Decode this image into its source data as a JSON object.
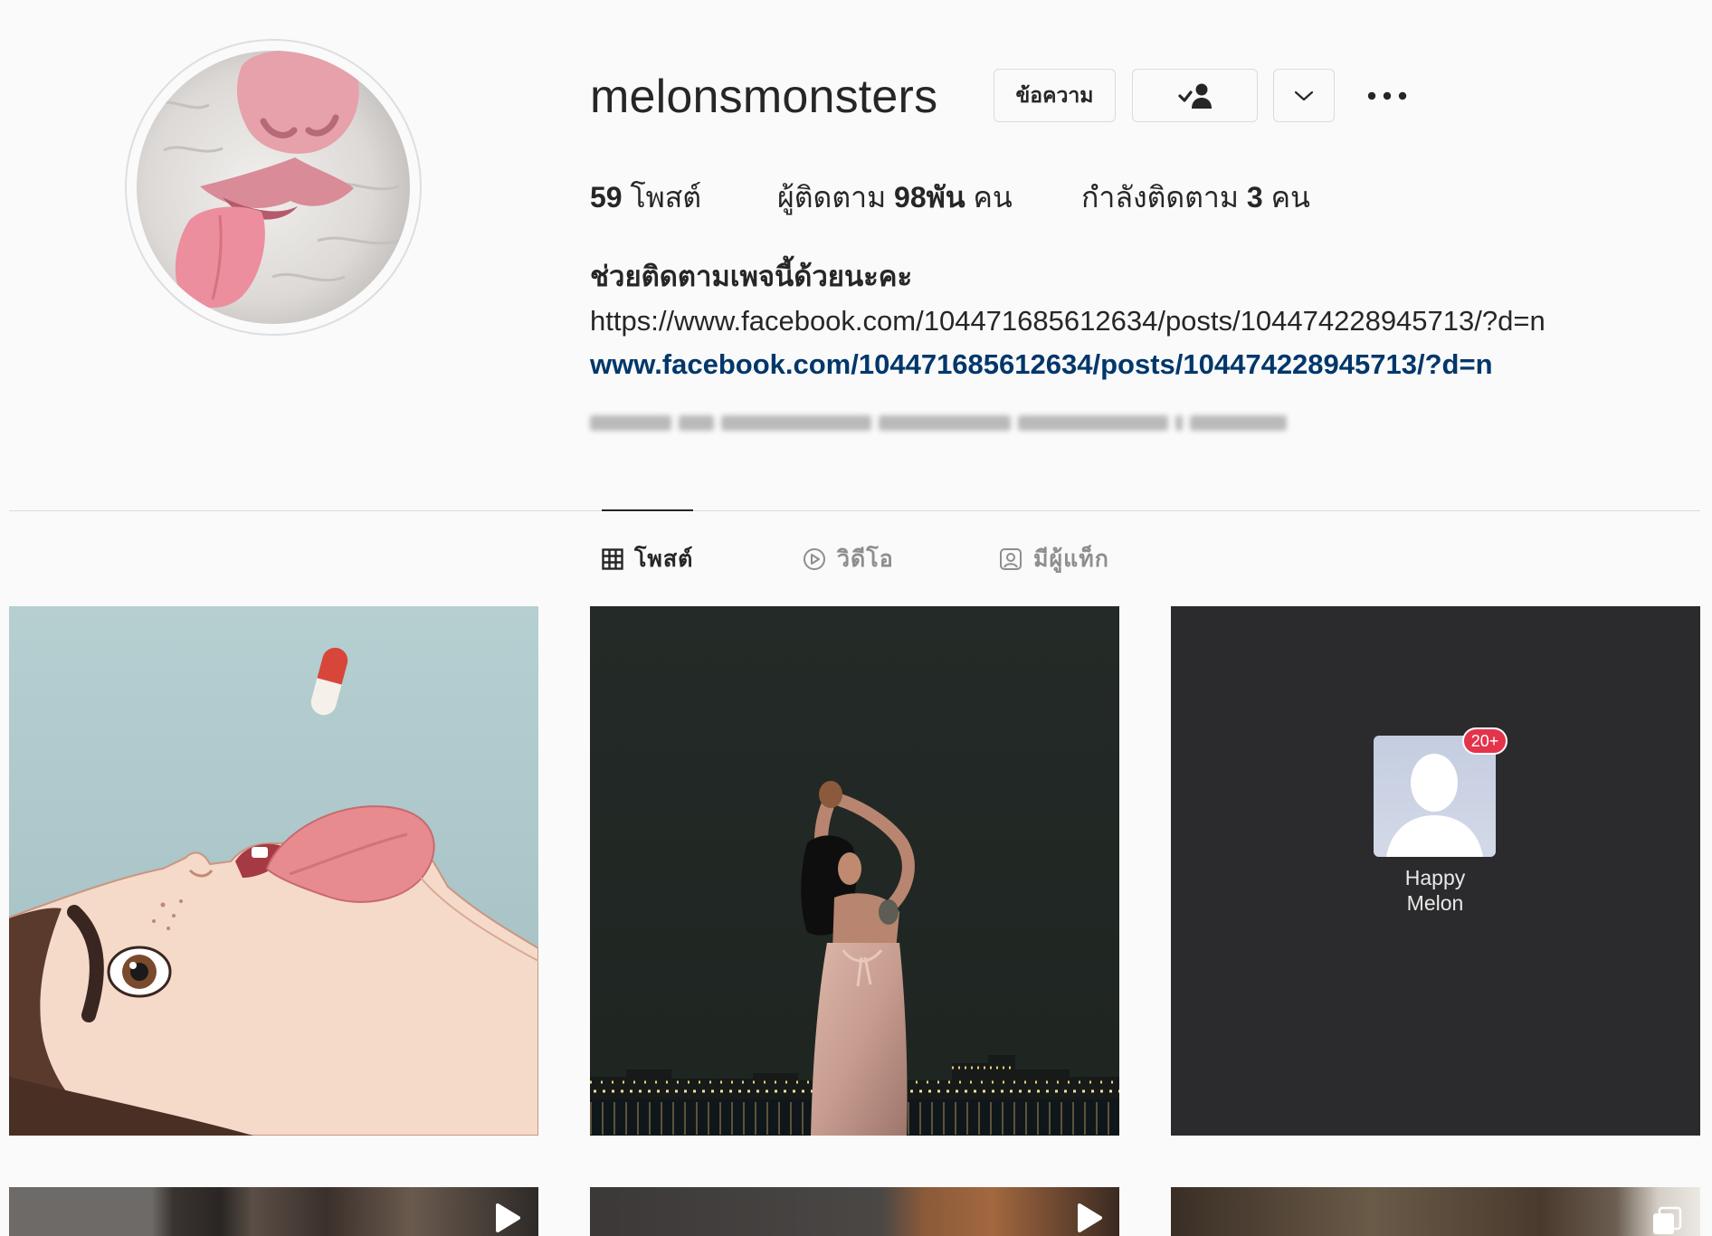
{
  "profile": {
    "username": "melonsmonsters",
    "buttons": {
      "message": "ข้อความ",
      "following_icon": "following-check-icon",
      "dropdown_icon": "chevron-down-icon",
      "more_icon": "more-dots-icon"
    },
    "stats": [
      {
        "value": "59",
        "label": "โพสต์"
      },
      {
        "label": "ผู้ติดตาม",
        "value": "98พัน",
        "unit": "คน"
      },
      {
        "label": "กำลังติดตาม",
        "value": "3",
        "unit": "คน"
      }
    ],
    "bio": {
      "title": "ช่วยติดตามเพจนี้ด้วยนะคะ",
      "url_text": "https://www.facebook.com/104471685612634/posts/104474228945713/?d=n",
      "link": "www.facebook.com/104471685612634/posts/104474228945713/?d=n"
    }
  },
  "tabs": [
    {
      "label": "โพสต์",
      "icon": "grid-icon",
      "active": true
    },
    {
      "label": "วิดีโอ",
      "icon": "play-circle-icon",
      "active": false
    },
    {
      "label": "มีผู้แท็ก",
      "icon": "tagged-icon",
      "active": false
    }
  ],
  "posts": [
    {},
    {},
    {
      "badge": "20+",
      "name_line1": "Happy",
      "name_line2": "Melon"
    },
    {
      "overlay_icon": "reel-play-icon"
    },
    {
      "overlay_icon": "reel-play-icon"
    },
    {
      "overlay_icon": "carousel-icon"
    }
  ],
  "colors": {
    "text": "#262626",
    "secondary_text": "#8e8e8e",
    "link": "#00376b",
    "border": "#dbdbdb",
    "background": "#fafafa",
    "badge": "#e3344c"
  }
}
